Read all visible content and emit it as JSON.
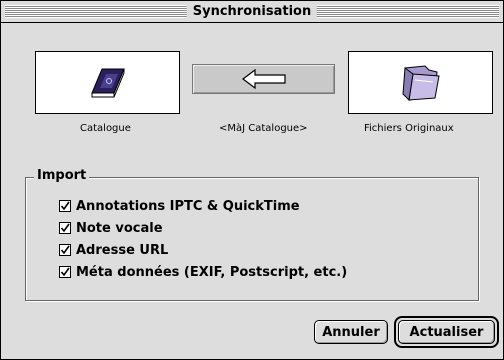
{
  "window": {
    "title": "Synchronisation"
  },
  "sources": {
    "left": {
      "icon": "book-icon",
      "label": "Catalogue"
    },
    "direction": {
      "icon": "arrow-left-icon",
      "label": "<MàJ Catalogue>"
    },
    "right": {
      "icon": "folder-icon",
      "label": "Fichiers Originaux"
    }
  },
  "import": {
    "label": "Import",
    "options": [
      {
        "label": "Annotations IPTC & QuickTime",
        "checked": true
      },
      {
        "label": "Note vocale",
        "checked": true
      },
      {
        "label": "Adresse URL",
        "checked": true
      },
      {
        "label": "Méta données (EXIF, Postscript, etc.)",
        "checked": true
      }
    ]
  },
  "buttons": {
    "cancel": "Annuler",
    "ok": "Actualiser"
  }
}
